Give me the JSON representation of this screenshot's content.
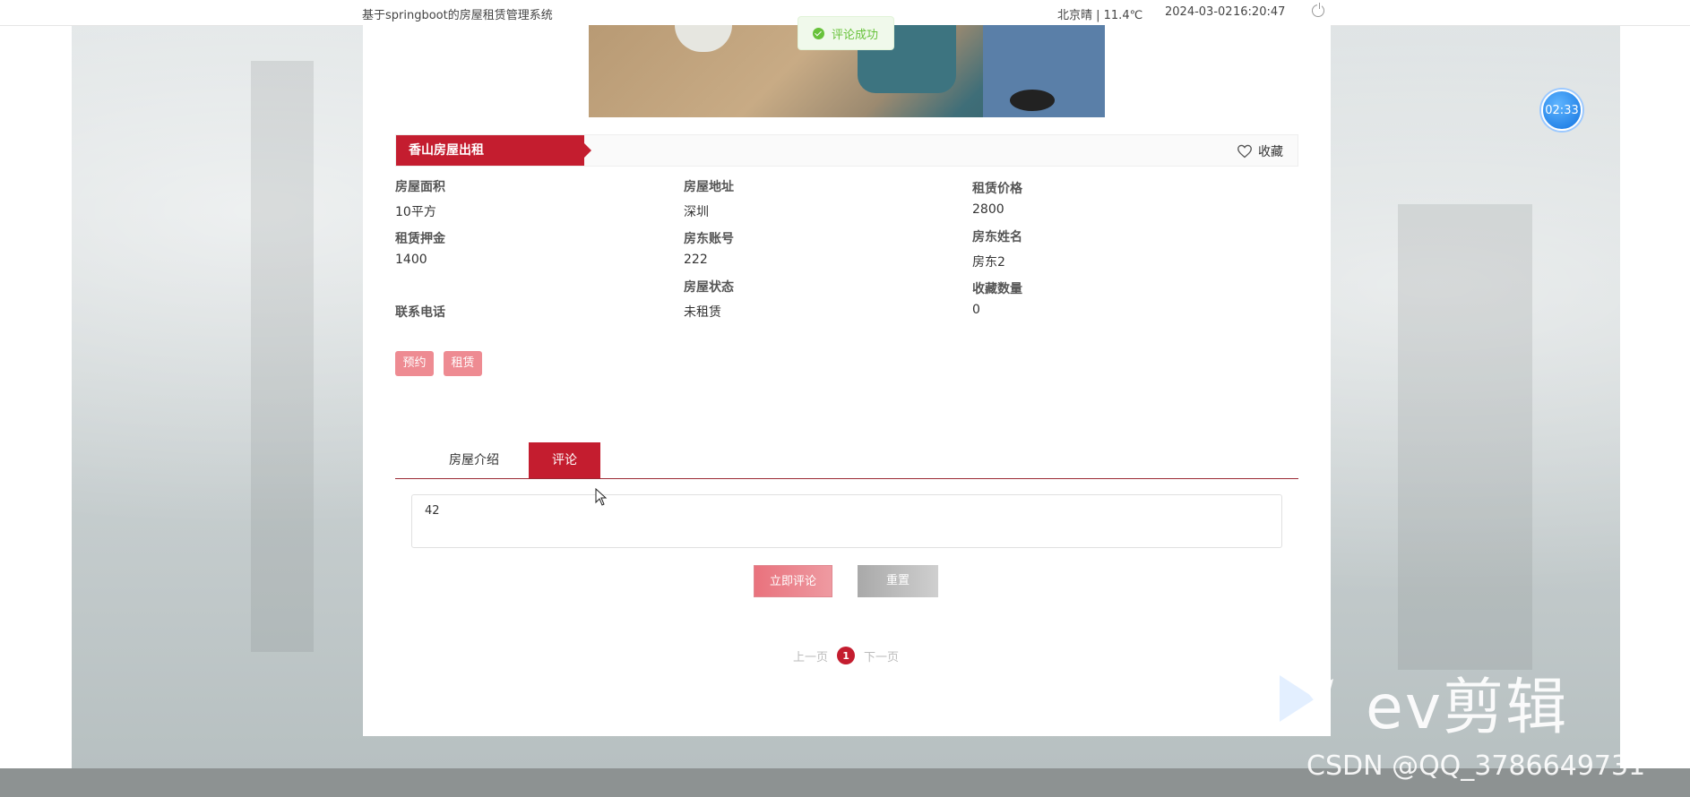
{
  "topbar": {
    "system_title": "基于springboot的房屋租赁管理系统",
    "weather": "北京晴 | 11.4℃",
    "date": "2024-03-02",
    "time": "16:20:47"
  },
  "toast": {
    "message": "评论成功"
  },
  "house": {
    "title": "香山房屋出租",
    "favorite_label": "收藏",
    "fields": {
      "area_label": "房屋面积",
      "area_value": "10平方",
      "address_label": "房屋地址",
      "address_value": "深圳",
      "price_label": "租赁价格",
      "price_value": "2800",
      "deposit_label": "租赁押金",
      "deposit_value": "1400",
      "landlord_account_label": "房东账号",
      "landlord_account_value": "222",
      "landlord_name_label": "房东姓名",
      "landlord_name_value": "房东2",
      "phone_label": "联系电话",
      "status_label": "房屋状态",
      "status_value": "未租赁",
      "fav_count_label": "收藏数量",
      "fav_count_value": "0"
    },
    "actions": {
      "reserve": "预约",
      "rent": "租赁"
    }
  },
  "tabs": [
    {
      "label": "房屋介绍",
      "active": false
    },
    {
      "label": "评论",
      "active": true
    }
  ],
  "comment": {
    "value": "42",
    "submit_label": "立即评论",
    "reset_label": "重置"
  },
  "pager": {
    "prev": "上一页",
    "current": "1",
    "next": "下一页"
  },
  "overlay": {
    "timer": "02:33",
    "ev_brand": "ev剪辑",
    "csdn": "CSDN @QQ_3786649731"
  },
  "colors": {
    "accent": "#c41d2f",
    "button_light": "#ee8b92",
    "success": "#67c23a"
  }
}
